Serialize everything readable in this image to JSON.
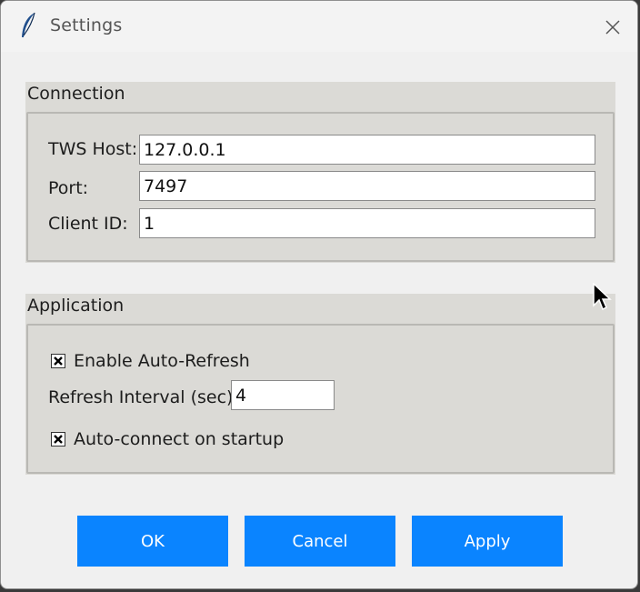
{
  "window": {
    "title": "Settings",
    "icon": "feather-icon",
    "close_icon": "close-icon"
  },
  "connection": {
    "header": "Connection",
    "host_label": "TWS Host:",
    "host_value": "127.0.0.1",
    "port_label": "Port:",
    "port_value": "7497",
    "client_id_label": "Client ID:",
    "client_id_value": "1"
  },
  "application": {
    "header": "Application",
    "auto_refresh_label": "Enable Auto-Refresh",
    "auto_refresh_checked": true,
    "refresh_interval_label": "Refresh Interval (sec):",
    "refresh_interval_value": "4",
    "auto_connect_label": "Auto-connect on startup",
    "auto_connect_checked": true
  },
  "buttons": {
    "ok": "OK",
    "cancel": "Cancel",
    "apply": "Apply"
  },
  "colors": {
    "button_bg": "#0a84ff",
    "group_bg": "#dbdad6",
    "window_bg": "#f0f0f0"
  }
}
